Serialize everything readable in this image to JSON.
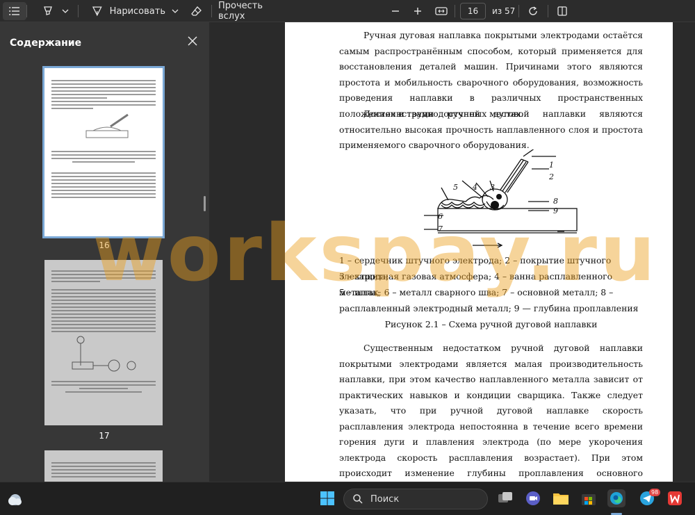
{
  "toolbar": {
    "draw_label": "Нарисовать",
    "read_aloud_label": "Прочесть вслух",
    "page_value": "16",
    "page_total": "из 57"
  },
  "sidebar": {
    "title": "Содержание",
    "thumbnails": [
      {
        "number": "16",
        "selected": true
      },
      {
        "number": "17",
        "selected": false
      }
    ]
  },
  "document": {
    "para1": "Ручная дуговая наплавка покрытыми электродами остаётся самым распространённым способом, который применяется для восстановления деталей машин. Причинами этого являются простота и мобильность сварочного оборудования, возможность проведения наплавки в различных пространственных положениях и труднодоступных местах.",
    "para2": "Достоинствами ручной дуговой наплавки являются относительно высокая прочность наплавленного слоя и простота применяемого сварочного оборудования.",
    "legend_line1": "1 – сердечник штучного электрода; 2 – покрытие штучного электрода;",
    "legend_line2": "3 – защитная газовая атмосфера; 4 – ванна расплавленного металла;",
    "legend_line3": "5 – шлак; 6 – металл сварного шва;  7 – основной металл; 8 – расплавленный электродный металл; 9 — глубина проплавления",
    "caption": "Рисунок 2.1 – Схема ручной дуговой наплавки",
    "para3": "Существенным недостатком ручной дуговой наплавки покрытыми электродами является малая производительность наплавки, при этом качество наплавленного металла зависит от практических навыков и кондиции сварщика. Также следует указать, что при ручной дуговой наплавке скорость расплавления электрода непостоянна в течение всего времени горения дуги и плавления электрода (по мере укорочения электрода скорость расплавления возрастает). При этом происходит изменение глубины проплавления основного металла, что объясняется изменением условий теплопередачи от дуги к основному металлу. Результатом этого является",
    "figure_labels": [
      "1",
      "2",
      "3",
      "4",
      "5",
      "6",
      "7",
      "8",
      "9"
    ]
  },
  "watermark": "workspay.ru",
  "taskbar": {
    "search_label": "Поиск",
    "telegram_badge": "98"
  },
  "icons": [
    "menu-icon",
    "highlighter-icon",
    "chevron-down-icon",
    "draw-icon",
    "eraser-icon",
    "zoom-out-icon",
    "zoom-in-icon",
    "fit-width-icon",
    "rotate-icon",
    "two-page-icon",
    "close-icon",
    "weather-icon",
    "windows-start-icon",
    "search-icon",
    "task-view-icon",
    "meet-icon",
    "file-explorer-icon",
    "store-icon",
    "edge-icon",
    "telegram-icon",
    "wps-office-icon"
  ],
  "colors": {
    "accent": "#7aa8d6",
    "watermark": "#eba01e",
    "toolbar_bg": "#2c2c2c",
    "sidebar_bg": "#373737"
  }
}
